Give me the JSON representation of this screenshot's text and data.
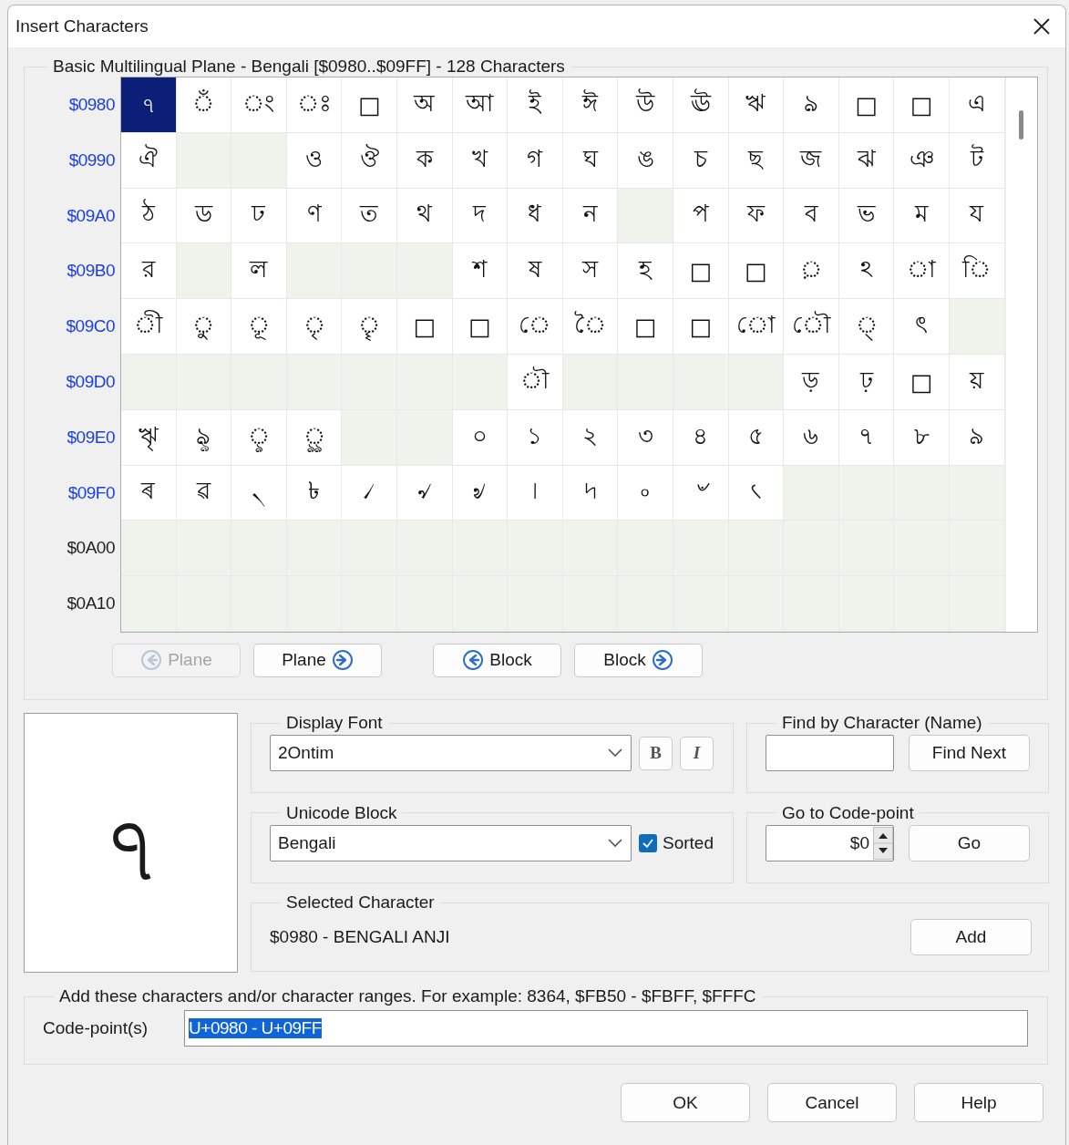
{
  "window": {
    "title": "Insert Characters"
  },
  "block_group": {
    "title": "Basic Multilingual Plane - Bengali [$0980..$09FF] - 128 Characters"
  },
  "grid_rows": [
    {
      "label": "$0980",
      "in_block": true,
      "cells": [
        {
          "kind": "glyph",
          "char": "ঀ",
          "selected": true
        },
        {
          "kind": "glyph",
          "char": "ঁ",
          "selected": false
        },
        {
          "kind": "glyph",
          "char": "ং",
          "selected": false
        },
        {
          "kind": "glyph",
          "char": "ঃ",
          "selected": false
        },
        {
          "kind": "glyph",
          "char": "□",
          "selected": false
        },
        {
          "kind": "glyph",
          "char": "অ",
          "selected": false
        },
        {
          "kind": "glyph",
          "char": "আ",
          "selected": false
        },
        {
          "kind": "glyph",
          "char": "ই",
          "selected": false
        },
        {
          "kind": "glyph",
          "char": "ঈ",
          "selected": false
        },
        {
          "kind": "glyph",
          "char": "উ",
          "selected": false
        },
        {
          "kind": "glyph",
          "char": "ঊ",
          "selected": false
        },
        {
          "kind": "glyph",
          "char": "ঋ",
          "selected": false
        },
        {
          "kind": "glyph",
          "char": "ঌ",
          "selected": false
        },
        {
          "kind": "glyph",
          "char": "□",
          "selected": false
        },
        {
          "kind": "glyph",
          "char": "□",
          "selected": false
        },
        {
          "kind": "glyph",
          "char": "এ",
          "selected": false
        }
      ]
    },
    {
      "label": "$0990",
      "in_block": true,
      "cells": [
        {
          "kind": "glyph",
          "char": "ঐ",
          "selected": false
        },
        {
          "kind": "empty",
          "selected": false
        },
        {
          "kind": "empty",
          "selected": false
        },
        {
          "kind": "glyph",
          "char": "ও",
          "selected": false
        },
        {
          "kind": "glyph",
          "char": "ঔ",
          "selected": false
        },
        {
          "kind": "glyph",
          "char": "ক",
          "selected": false
        },
        {
          "kind": "glyph",
          "char": "খ",
          "selected": false
        },
        {
          "kind": "glyph",
          "char": "গ",
          "selected": false
        },
        {
          "kind": "glyph",
          "char": "ঘ",
          "selected": false
        },
        {
          "kind": "glyph",
          "char": "ঙ",
          "selected": false
        },
        {
          "kind": "glyph",
          "char": "চ",
          "selected": false
        },
        {
          "kind": "glyph",
          "char": "ছ",
          "selected": false
        },
        {
          "kind": "glyph",
          "char": "জ",
          "selected": false
        },
        {
          "kind": "glyph",
          "char": "ঝ",
          "selected": false
        },
        {
          "kind": "glyph",
          "char": "ঞ",
          "selected": false
        },
        {
          "kind": "glyph",
          "char": "ট",
          "selected": false
        }
      ]
    },
    {
      "label": "$09A0",
      "in_block": true,
      "cells": [
        {
          "kind": "glyph",
          "char": "ঠ",
          "selected": false
        },
        {
          "kind": "glyph",
          "char": "ড",
          "selected": false
        },
        {
          "kind": "glyph",
          "char": "ঢ",
          "selected": false
        },
        {
          "kind": "glyph",
          "char": "ণ",
          "selected": false
        },
        {
          "kind": "glyph",
          "char": "ত",
          "selected": false
        },
        {
          "kind": "glyph",
          "char": "থ",
          "selected": false
        },
        {
          "kind": "glyph",
          "char": "দ",
          "selected": false
        },
        {
          "kind": "glyph",
          "char": "ধ",
          "selected": false
        },
        {
          "kind": "glyph",
          "char": "ন",
          "selected": false
        },
        {
          "kind": "empty",
          "selected": false
        },
        {
          "kind": "glyph",
          "char": "প",
          "selected": false
        },
        {
          "kind": "glyph",
          "char": "ফ",
          "selected": false
        },
        {
          "kind": "glyph",
          "char": "ব",
          "selected": false
        },
        {
          "kind": "glyph",
          "char": "ভ",
          "selected": false
        },
        {
          "kind": "glyph",
          "char": "ম",
          "selected": false
        },
        {
          "kind": "glyph",
          "char": "য",
          "selected": false
        }
      ]
    },
    {
      "label": "$09B0",
      "in_block": true,
      "cells": [
        {
          "kind": "glyph",
          "char": "র",
          "selected": false
        },
        {
          "kind": "empty",
          "selected": false
        },
        {
          "kind": "glyph",
          "char": "ল",
          "selected": false
        },
        {
          "kind": "empty",
          "selected": false
        },
        {
          "kind": "empty",
          "selected": false
        },
        {
          "kind": "empty",
          "selected": false
        },
        {
          "kind": "glyph",
          "char": "শ",
          "selected": false
        },
        {
          "kind": "glyph",
          "char": "ষ",
          "selected": false
        },
        {
          "kind": "glyph",
          "char": "স",
          "selected": false
        },
        {
          "kind": "glyph",
          "char": "হ",
          "selected": false
        },
        {
          "kind": "glyph",
          "char": "□",
          "selected": false
        },
        {
          "kind": "glyph",
          "char": "□",
          "selected": false
        },
        {
          "kind": "glyph",
          "char": "়",
          "selected": false
        },
        {
          "kind": "glyph",
          "char": "ঽ",
          "selected": false
        },
        {
          "kind": "glyph",
          "char": "া",
          "selected": false
        },
        {
          "kind": "glyph",
          "char": "ি",
          "selected": false
        }
      ]
    },
    {
      "label": "$09C0",
      "in_block": true,
      "cells": [
        {
          "kind": "glyph",
          "char": "ী",
          "selected": false
        },
        {
          "kind": "glyph",
          "char": "ু",
          "selected": false
        },
        {
          "kind": "glyph",
          "char": "ূ",
          "selected": false
        },
        {
          "kind": "glyph",
          "char": "ৃ",
          "selected": false
        },
        {
          "kind": "glyph",
          "char": "ৄ",
          "selected": false
        },
        {
          "kind": "glyph",
          "char": "□",
          "selected": false
        },
        {
          "kind": "glyph",
          "char": "□",
          "selected": false
        },
        {
          "kind": "glyph",
          "char": "ে",
          "selected": false
        },
        {
          "kind": "glyph",
          "char": "ৈ",
          "selected": false
        },
        {
          "kind": "glyph",
          "char": "□",
          "selected": false
        },
        {
          "kind": "glyph",
          "char": "□",
          "selected": false
        },
        {
          "kind": "glyph",
          "char": "ো",
          "selected": false
        },
        {
          "kind": "glyph",
          "char": "ৌ",
          "selected": false
        },
        {
          "kind": "glyph",
          "char": "্",
          "selected": false
        },
        {
          "kind": "glyph",
          "char": "ৎ",
          "selected": false
        },
        {
          "kind": "empty",
          "selected": false
        }
      ]
    },
    {
      "label": "$09D0",
      "in_block": true,
      "cells": [
        {
          "kind": "empty",
          "selected": false
        },
        {
          "kind": "empty",
          "selected": false
        },
        {
          "kind": "empty",
          "selected": false
        },
        {
          "kind": "empty",
          "selected": false
        },
        {
          "kind": "empty",
          "selected": false
        },
        {
          "kind": "empty",
          "selected": false
        },
        {
          "kind": "empty",
          "selected": false
        },
        {
          "kind": "glyph",
          "char": "ৗ",
          "selected": false
        },
        {
          "kind": "empty",
          "selected": false
        },
        {
          "kind": "empty",
          "selected": false
        },
        {
          "kind": "empty",
          "selected": false
        },
        {
          "kind": "empty",
          "selected": false
        },
        {
          "kind": "glyph",
          "char": "ড়",
          "selected": false
        },
        {
          "kind": "glyph",
          "char": "ঢ়",
          "selected": false
        },
        {
          "kind": "glyph",
          "char": "□",
          "selected": false
        },
        {
          "kind": "glyph",
          "char": "য়",
          "selected": false
        }
      ]
    },
    {
      "label": "$09E0",
      "in_block": true,
      "cells": [
        {
          "kind": "glyph",
          "char": "ৠ",
          "selected": false
        },
        {
          "kind": "glyph",
          "char": "ৡ",
          "selected": false
        },
        {
          "kind": "glyph",
          "char": "ৢ",
          "selected": false
        },
        {
          "kind": "glyph",
          "char": "ৣ",
          "selected": false
        },
        {
          "kind": "empty",
          "selected": false
        },
        {
          "kind": "empty",
          "selected": false
        },
        {
          "kind": "glyph",
          "char": "০",
          "selected": false
        },
        {
          "kind": "glyph",
          "char": "১",
          "selected": false
        },
        {
          "kind": "glyph",
          "char": "২",
          "selected": false
        },
        {
          "kind": "glyph",
          "char": "৩",
          "selected": false
        },
        {
          "kind": "glyph",
          "char": "৪",
          "selected": false
        },
        {
          "kind": "glyph",
          "char": "৫",
          "selected": false
        },
        {
          "kind": "glyph",
          "char": "৬",
          "selected": false
        },
        {
          "kind": "glyph",
          "char": "৭",
          "selected": false
        },
        {
          "kind": "glyph",
          "char": "৮",
          "selected": false
        },
        {
          "kind": "glyph",
          "char": "৯",
          "selected": false
        }
      ]
    },
    {
      "label": "$09F0",
      "in_block": true,
      "cells": [
        {
          "kind": "glyph",
          "char": "ৰ",
          "selected": false
        },
        {
          "kind": "glyph",
          "char": "ৱ",
          "selected": false
        },
        {
          "kind": "glyph",
          "char": "৲",
          "selected": false
        },
        {
          "kind": "glyph",
          "char": "৳",
          "selected": false
        },
        {
          "kind": "glyph",
          "char": "৴",
          "selected": false
        },
        {
          "kind": "glyph",
          "char": "৵",
          "selected": false
        },
        {
          "kind": "glyph",
          "char": "৶",
          "selected": false
        },
        {
          "kind": "glyph",
          "char": "৷",
          "selected": false
        },
        {
          "kind": "glyph",
          "char": "৸",
          "selected": false
        },
        {
          "kind": "glyph",
          "char": "৹",
          "selected": false
        },
        {
          "kind": "glyph",
          "char": "৺",
          "selected": false
        },
        {
          "kind": "glyph",
          "char": "৻",
          "selected": false
        },
        {
          "kind": "empty",
          "selected": false
        },
        {
          "kind": "empty",
          "selected": false
        },
        {
          "kind": "empty",
          "selected": false
        },
        {
          "kind": "empty",
          "selected": false
        }
      ]
    },
    {
      "label": "$0A00",
      "in_block": false,
      "cells": [
        {
          "kind": "empty",
          "selected": false
        },
        {
          "kind": "empty",
          "selected": false
        },
        {
          "kind": "empty",
          "selected": false
        },
        {
          "kind": "empty",
          "selected": false
        },
        {
          "kind": "empty",
          "selected": false
        },
        {
          "kind": "empty",
          "selected": false
        },
        {
          "kind": "empty",
          "selected": false
        },
        {
          "kind": "empty",
          "selected": false
        },
        {
          "kind": "empty",
          "selected": false
        },
        {
          "kind": "empty",
          "selected": false
        },
        {
          "kind": "empty",
          "selected": false
        },
        {
          "kind": "empty",
          "selected": false
        },
        {
          "kind": "empty",
          "selected": false
        },
        {
          "kind": "empty",
          "selected": false
        },
        {
          "kind": "empty",
          "selected": false
        },
        {
          "kind": "empty",
          "selected": false
        }
      ]
    },
    {
      "label": "$0A10",
      "in_block": false,
      "cells": [
        {
          "kind": "empty",
          "selected": false
        },
        {
          "kind": "empty",
          "selected": false
        },
        {
          "kind": "empty",
          "selected": false
        },
        {
          "kind": "empty",
          "selected": false
        },
        {
          "kind": "empty",
          "selected": false
        },
        {
          "kind": "empty",
          "selected": false
        },
        {
          "kind": "empty",
          "selected": false
        },
        {
          "kind": "empty",
          "selected": false
        },
        {
          "kind": "empty",
          "selected": false
        },
        {
          "kind": "empty",
          "selected": false
        },
        {
          "kind": "empty",
          "selected": false
        },
        {
          "kind": "empty",
          "selected": false
        },
        {
          "kind": "empty",
          "selected": false
        },
        {
          "kind": "empty",
          "selected": false
        },
        {
          "kind": "empty",
          "selected": false
        },
        {
          "kind": "empty",
          "selected": false
        }
      ]
    }
  ],
  "nav_buttons": [
    {
      "label": "Plane",
      "kind": "back",
      "disabled": true
    },
    {
      "label": "Plane",
      "kind": "forward",
      "disabled": false
    },
    {
      "label": "Block",
      "kind": "back",
      "disabled": false
    },
    {
      "label": "Block",
      "kind": "forward",
      "disabled": false
    }
  ],
  "preview": {
    "char": "ঀ"
  },
  "display_font": {
    "title": "Display Font",
    "value": "2Ontim",
    "bold_label": "B",
    "italic_label": "I",
    "bold": false,
    "italic": false
  },
  "find": {
    "title": "Find by Character (Name)",
    "button": "Find Next"
  },
  "unicode_block": {
    "title": "Unicode Block",
    "value": "Bengali",
    "sorted_label": "Sorted",
    "sorted": true
  },
  "goto": {
    "title": "Go to Code-point",
    "value": "$0",
    "button": "Go"
  },
  "selected_character": {
    "title": "Selected Character",
    "text": "$0980 - BENGALI ANJI",
    "button": "Add"
  },
  "add_ranges": {
    "title": "Add these characters and/or character ranges. For example: 8364, $FB50 - $FBFF, $FFFC",
    "label": "Code-point(s)",
    "value": "U+0980 - U+09FF",
    "value_selected": true
  },
  "buttons": [
    "OK",
    "Cancel",
    "Help"
  ]
}
